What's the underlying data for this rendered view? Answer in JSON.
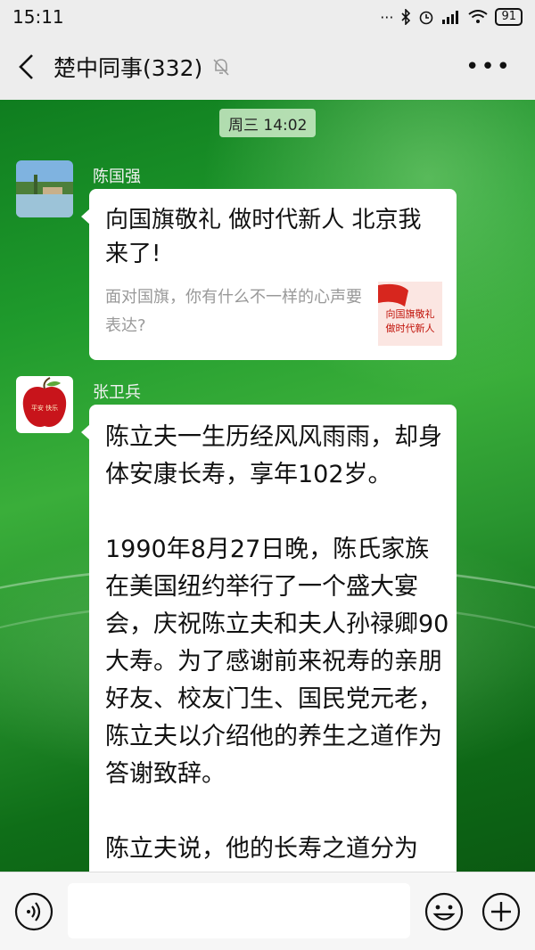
{
  "status_bar": {
    "time": "15:11",
    "battery": "91"
  },
  "header": {
    "title": "楚中同事(332)"
  },
  "chat": {
    "timestamp": "周三 14:02",
    "messages": [
      {
        "sender": "陈国强",
        "link_title": "向国旗敬礼 做时代新人 北京我来了!",
        "link_desc": "面对国旗，你有什么不一样的心声要表达?",
        "thumb_line1": "向国旗敬礼",
        "thumb_line2": "做时代新人"
      },
      {
        "sender": "张卫兵",
        "avatar_text": "平安 快乐",
        "text": "陈立夫一生历经风风雨雨，却身体安康长寿，享年102岁。\n\n1990年8月27日晚，陈氏家族在美国纽约举行了一个盛大宴会，庆祝陈立夫和夫人孙禄卿90大寿。为了感谢前来祝寿的亲朋好友、校友门生、国民党元老，陈立夫以介绍他的养生之道作为答谢致辞。\n\n陈立夫说，他的长寿之道分为"
      }
    ]
  },
  "colors": {
    "chat_bg": "#1f9a2c",
    "bubble": "#ffffff",
    "bar": "#ededed"
  }
}
